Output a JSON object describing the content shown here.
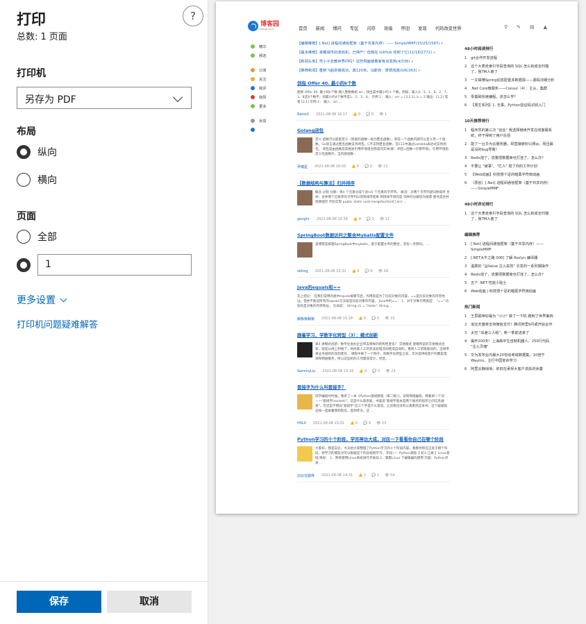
{
  "panel": {
    "title": "打印",
    "count": "总数: 1 页面",
    "help_label": "?",
    "printer_label": "打印机",
    "printer_value": "另存为 PDF",
    "layout_label": "布局",
    "layout_portrait": "纵向",
    "layout_landscape": "横向",
    "layout_selected": "portrait",
    "pages_label": "页面",
    "pages_all": "全部",
    "pages_custom_value": "1",
    "pages_selected": "custom",
    "more_settings": "更多设置",
    "troubleshoot": "打印机问题疑难解答",
    "save": "保存",
    "cancel": "取消"
  },
  "preview": {
    "logo": "博客园",
    "logo_sub": "cnblogs.com",
    "nav": [
      "首页",
      "新闻",
      "博问",
      "专区",
      "闪存",
      "班级",
      "怀旧",
      "发现",
      "代码改变世界"
    ],
    "nav_icons": [
      "search-icon",
      "pen-icon",
      "note-icon",
      "bell-icon"
    ],
    "sidebar": [
      {
        "label": "精华",
        "color": "#7cc242"
      },
      {
        "label": "候选",
        "color": "#7cc242"
      },
      {
        "label": "订阅",
        "color": "#e89a3a"
      },
      {
        "label": "关注",
        "color": "#f2a93b"
      },
      {
        "label": "我评",
        "color": "#1a77d2"
      },
      {
        "label": "我赞",
        "color": "#e03a3a"
      },
      {
        "label": "更多",
        "color": "#7cc242"
      },
      {
        "label": "反馈",
        "color": "#999999"
      }
    ],
    "pins": [
      "【编辑推荐】[.Net] 进程间通信框架（基于共享内存）—— SimpleMMF(15/25/1587) »",
      "【最多推荐】承载城市的游戏机，已停产！但我在 GitHub 找到了它(11/18/2772) »",
      "【新闻头条】凭小子去教世界问吗？这些网面装着家有点发热(4/336) »",
      "【推荐新闻】重新飞船拼接成功，真120米，马斯克：梦想成真(0/6/263) »"
    ],
    "posts": [
      {
        "title": "剑指 Offer 40. 最小的k个数",
        "summary": "题目 Offer 40. 最小的k个数 输入整数数组 arr，找出其中最小的 k 个数。例如，输入4、5、1、6、2、7、3、8这8个数字，则最小的4个数字是1、2、3、4。 示例 1： 输入：arr = [3,2,1], k = 2 输出：[1,2] 或者 [2,1] 示例 2： 输入：arr ...",
        "author": "RainsX",
        "time": "2021-08-08 16:17",
        "likes": "0",
        "comments": "0",
        "views": "1",
        "thumb": "none"
      },
      {
        "title": "Golang闭包",
        "summary": "定义 函数可以嵌套定义（嵌套的函数一般为匿名函数），即在一个函数内部可以定义另一个函数。Go语言通过匿名函数支持闭包，C不支持匿名函数，在C11中通过Lambda表达式支持闭包。 闭包是由函数及其相关引用环境组合而成的实体(即：闭包=函数+引用环境)。引用环境指定义在函数外，当内部函数... ",
        "author": "尹瑞星",
        "time": "2021-08-08 16:03",
        "likes": "0",
        "comments": "0",
        "views": "12",
        "thumb": "photo"
      },
      {
        "title": "【数据结构与算法】归并排序",
        "summary": "概念 过程 分解：将n 个元素分成个含n/2 个元素的子序列。 解决：对两个子序列递归地排序 合并：合并两个已排序的子序列以得到排序结果 和快排不同的是 归并的分解较为随意 重点是合并 简要图示 代码实现 public static void mergeSort(int[] arr) ...",
        "author": "gonghr",
        "time": "2021-08-08 15:56",
        "likes": "0",
        "comments": "0",
        "views": "11",
        "thumb": "photo"
      },
      {
        "title": "SpringBoot数据访问之整合Mybatis配置文件",
        "summary": "该博客是按理SpringBoot中mybatis，基于配置文件的整合，涉及一点原码。 ...",
        "author": "xbhog",
        "time": "2021-08-08 15:32",
        "likes": "0",
        "comments": "0",
        "views": "28",
        "thumb": "photo"
      },
      {
        "title": "Java的equals和==",
        "summary": "先上结论： 在我们常用的类中equals被重写后，作用就是为了比较对象的内容，==是比较对象的内存地址。但并不能说所有的equals方法就是比较对象的内容。 Java中的==： 1、对于对象引用类型： \"==\" 比较的是对象的内存地址。 比如说： String s1 = \"Hello\"; String ...",
        "author": "躺板板躺板",
        "time": "2021-08-08 15:18",
        "likes": "0",
        "comments": "0",
        "views": "22",
        "thumb": "none"
      },
      {
        "title": "跟着学习，学数字化转型（3）：模式创新",
        "summary": "第4 讲模式创新：数字化会办企业带去哪样的结构性变化？ 交易模式 建模所说的交易模式创新，就是从线上到线下，将商家人工的买卖处理流动变成自动的，重新人工智能驱动的。这将带来业务组织的深刻变化... 课程中举了一个例子，布数字化转型之前，华为提供给客户的都是电源和物质服务，所以这些机的工作量非常大，然后，...",
        "author": "SammyLiu",
        "time": "2021-08-08 15:16",
        "likes": "0",
        "comments": "0",
        "views": "23",
        "thumb": "qr"
      },
      {
        "title": "套接字为什么叫套接字？",
        "summary": "同学编程时时候，我买了一本《Python基础教程（第二版）》，读到网络编程，我看到一个词——\"套接字(socket)\"，这是什么意思呢。书里说\"套接字基本是两个端点的程序之间信息通道\"，可还是不明白\"套接字\"这三个字是什么意思。之前我也没有认真看完这本书，这个疑惑就这样一直跟着我到现在，直到昨天，这 ...",
        "author": "HSL0",
        "time": "2021-08-08 15:01",
        "likes": "0",
        "comments": "0",
        "views": "23",
        "thumb": "cartoon"
      },
      {
        "title": "Python学习的十个阶段，学完神功大成，对应一下看看你自己在哪个阶段",
        "summary": "大家好，我是白云。今天给大家整理了Python学习的十个阶段内容，看看你现在正处于哪个阶段，想学习的朋友也可以根据这个阶段规划学习。 阶段一：Python基础【 初入江湖 】Linux基础 目标： 1、熟练使用Linux系统进行开发动 2、掌握Linux 下编辑器的使用 内容：Python开发 ...",
        "author": "白云在掘林",
        "time": "2021-08-08 14:31",
        "likes": "2",
        "comments": "2",
        "views": "54",
        "thumb": "emoji"
      }
    ],
    "right": [
      {
        "head": "48小时阅读排行",
        "items": [
          "git合作开发流程",
          "这个大表走索引字段查询的 SQL 怎么就成全扫描了，我TM人傻了",
          "一文搞懂Spring动态配置多数据源——源码详细分析",
          ".Net Core微服务——Consul（4）：主从、集群",
          "零基础快速编程，该怎么学？",
          "【周生系列】1. 无事。Python验证码识别入门"
        ]
      },
      {
        "head": "10天推荐排行",
        "items": [
          "程序员的第三次 \"创业\" 我选择继续开发在线客服系统，终于得到了用户反馈",
          "能了一台华为云服务器，却直接被封公网ip，而且最是没的bug导致！",
          "Redis挂了，流量把数据库也打挂了，怎么办？",
          "不要让 \"破事\"、\"烂人\" 搅了你的工作计划",
          "【Web动画】科技感十足的暗黑字符雨动画",
          "（原创）[.Net] 进程间通信框架（基于共享内存）——SimpleMMF"
        ]
      },
      {
        "head": "48小时评论排行",
        "items": [
          "这个大表走索引字段查询的 SQL 怎么就成全扫描了，我TM人傻了"
        ]
      },
      {
        "head": "编辑推荐",
        "items": [
          "[.Net] 进程间通信框架（基于共享内存）——SimpleMMF",
          "[.NET大牛之路 006] 了解 Roslyn 编译器",
          "温柔的 \"@Value 注入失败\" 引发的一系列撰操作",
          "Redis挂了，流量把数据库也打挂了，怎么办？",
          "五个 .NET 性能小贴士",
          "Web动画 | 科技感十足的暗黑字符雨动画"
        ]
      },
      {
        "head": "热门新闻",
        "items": [
          "王思聪帝钞最为 \"小小\" 做了一下机 跑到了世界第四",
          "淘宝天猫将支持微信支付！腾讯阿里9月或开始合作",
          "太空 \"出差三人组\"，新一季前进来了",
          "撬杆200天！上海高中生自制机器人，250行代码 \"注入灵魂\"",
          "华为发布业内最大20包动考域数据集，10倍于Waymo，主打中国复杂学习",
          "阿里云静悄悄：依旧在承受大客户流失的余震"
        ]
      }
    ]
  }
}
